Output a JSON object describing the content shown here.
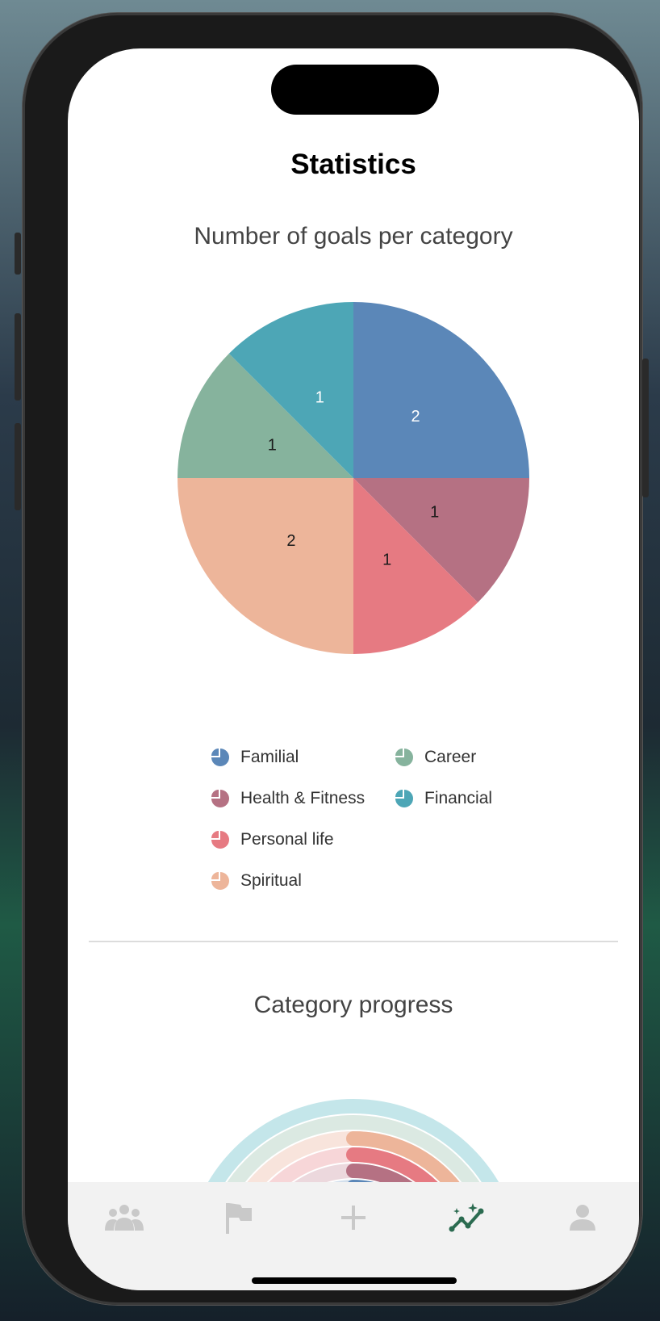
{
  "screen": {
    "title": "Statistics",
    "pie_section_title": "Number of goals per category",
    "progress_section_title": "Category progress"
  },
  "chart_data": [
    {
      "type": "pie",
      "title": "Number of goals per category",
      "slices": [
        {
          "label": "Familial",
          "value": 2,
          "color": "#5b87b8"
        },
        {
          "label": "Health & Fitness",
          "value": 1,
          "color": "#b57183"
        },
        {
          "label": "Personal life",
          "value": 1,
          "color": "#e67a82"
        },
        {
          "label": "Spiritual",
          "value": 2,
          "color": "#edb59a"
        },
        {
          "label": "Career",
          "value": 1,
          "color": "#86b39d"
        },
        {
          "label": "Financial",
          "value": 1,
          "color": "#4da6b6"
        }
      ]
    }
  ],
  "legend": [
    {
      "label": "Familial",
      "color": "#5b87b8"
    },
    {
      "label": "Career",
      "color": "#86b39d"
    },
    {
      "label": "Health & Fitness",
      "color": "#b57183"
    },
    {
      "label": "Financial",
      "color": "#4da6b6"
    },
    {
      "label": "Personal life",
      "color": "#e67a82"
    },
    {
      "label": "Spiritual",
      "color": "#edb59a"
    }
  ],
  "category_progress": [
    {
      "category": "Financial",
      "color": "#4da6b6",
      "track": "#c4e6ea",
      "progress": 0
    },
    {
      "category": "Career",
      "color": "#86b39d",
      "track": "#dbe9e2",
      "progress": 0
    },
    {
      "category": "Spiritual",
      "color": "#edb59a",
      "track": "#f8e4dc",
      "progress": 0.5
    },
    {
      "category": "Personal life",
      "color": "#e67a82",
      "track": "#f7d6d8",
      "progress": 1
    },
    {
      "category": "Health & Fitness",
      "color": "#b57183",
      "track": "#ecd8dd",
      "progress": 1
    },
    {
      "category": "Familial",
      "color": "#5b87b8",
      "track": "#d3dfec",
      "progress": 0.5
    }
  ],
  "tabs": [
    {
      "name": "community-tab",
      "icon": "people-icon",
      "active": false
    },
    {
      "name": "goals-tab",
      "icon": "flag-icon",
      "active": false
    },
    {
      "name": "add-tab",
      "icon": "plus-icon",
      "active": false
    },
    {
      "name": "statistics-tab",
      "icon": "trend-sparkle-icon",
      "active": true
    },
    {
      "name": "profile-tab",
      "icon": "person-icon",
      "active": false
    }
  ],
  "colors": {
    "tab_active": "#2b6b50",
    "tab_inactive": "#c9c9c9"
  }
}
